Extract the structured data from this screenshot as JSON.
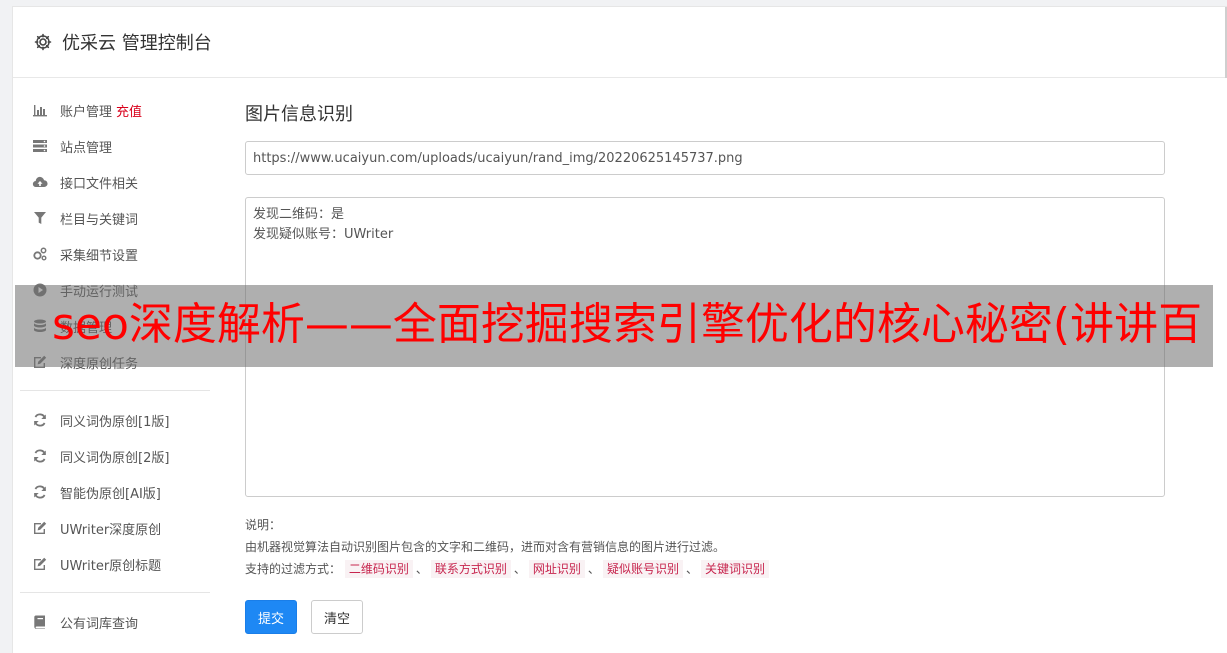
{
  "app": {
    "title": "优采云 管理控制台",
    "icon": "gear-icon"
  },
  "sidebar": {
    "groups": [
      [
        {
          "label": "账户管理",
          "icon": "bar-chart-icon",
          "extra": "充值"
        },
        {
          "label": "站点管理",
          "icon": "server-icon"
        },
        {
          "label": "接口文件相关",
          "icon": "cloud-upload-icon"
        },
        {
          "label": "栏目与关键词",
          "icon": "filter-icon"
        },
        {
          "label": "采集细节设置",
          "icon": "cogs-icon"
        },
        {
          "label": "手动运行测试",
          "icon": "play-circle-icon"
        },
        {
          "label": "数据管理",
          "icon": "database-icon"
        },
        {
          "label": "深度原创任务",
          "icon": "edit-icon"
        }
      ],
      [
        {
          "label": "同义词伪原创[1版]",
          "icon": "refresh-icon"
        },
        {
          "label": "同义词伪原创[2版]",
          "icon": "refresh-icon"
        },
        {
          "label": "智能伪原创[AI版]",
          "icon": "refresh-icon"
        },
        {
          "label": "UWriter深度原创",
          "icon": "edit-icon"
        },
        {
          "label": "UWriter原创标题",
          "icon": "edit-icon"
        }
      ],
      [
        {
          "label": "公有词库查询",
          "icon": "book-icon"
        }
      ]
    ],
    "accent_color": "#d9001b"
  },
  "main": {
    "heading": "图片信息识别",
    "url_value": "https://www.ucaiyun.com/uploads/ucaiyun/rand_img/20220625145737.png",
    "result_text": "发现二维码：是\n发现疑似账号：UWriter",
    "notes": {
      "title": "说明：",
      "desc": "由机器视觉算法自动识别图片包含的文字和二维码，进而对含有营销信息的图片进行过滤。",
      "filters_label": "支持的过滤方式：",
      "filters": [
        "二维码识别",
        "联系方式识别",
        "网址识别",
        "疑似账号识别",
        "关键词识别"
      ],
      "separator": "、"
    },
    "submit_label": "提交",
    "clear_label": "清空",
    "primary_color": "#1e88f4"
  },
  "overlay": {
    "text": "seo深度解析——全面挖掘搜索引擎优化的核心秘密(讲讲百",
    "color": "#ff0000"
  }
}
